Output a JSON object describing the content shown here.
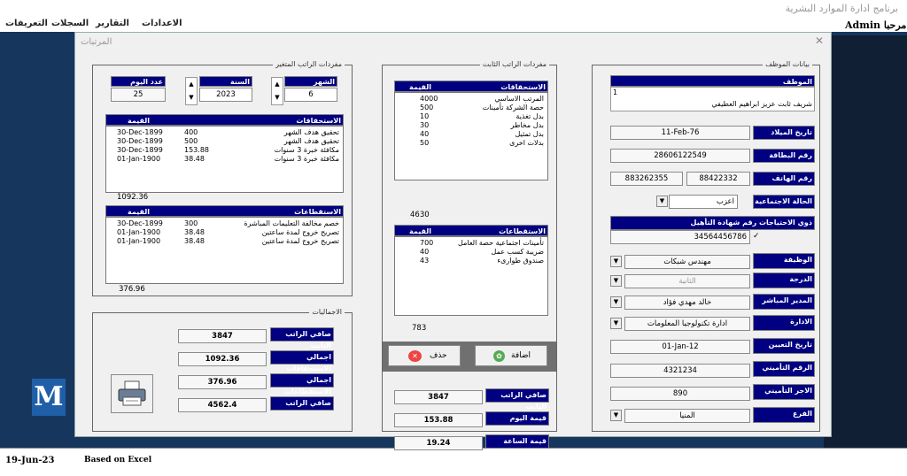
{
  "window": {
    "title": "برنامج ادارة الموارد البشرية",
    "welcome": "مرحبا Admin"
  },
  "menu": [
    "التعريفات",
    "السجلات",
    "التقارير",
    "الاعدادات"
  ],
  "status": {
    "date": "19-Jun-23",
    "based_on": "Based on Excel"
  },
  "logo_letter": "M",
  "dialog": {
    "title": "المرتبات",
    "close": "✕"
  },
  "employee": {
    "frame_label": "بيانات الموظف",
    "name_label": "الموظف",
    "id": "1",
    "name": "شريف ثابت عزيز ابراهيم العطيفي",
    "birth_label": "تاريخ الميلاد",
    "birth": "11-Feb-76",
    "card_label": "رقم البطاقة",
    "card": "28606122549",
    "phone_label": "رقم الهاتف",
    "phone1": "88422332",
    "phone2": "883262355",
    "social_label": "الحالة الاجتماعية",
    "social": "اعزب",
    "special_label": "ذوي الاحتياجات",
    "cert_label": "رقم شهادة التأهيل",
    "cert": "34564456786",
    "cert_check": "✓",
    "job_label": "الوظيفة",
    "job": "مهندس شبكات",
    "grade_label": "الدرجة",
    "grade": "الثانية",
    "manager_label": "المدير المباشر",
    "manager": "خالد مهدي فؤاد",
    "dept_label": "الادارة",
    "dept": "ادارة تكنولوجيا المعلومات",
    "hire_label": "تاريخ التعيين",
    "hire": "01-Jan-12",
    "ins_label": "الرقم التأميني",
    "ins": "4321234",
    "wage_label": "الاجر التأميني",
    "wage": "890",
    "branch_label": "الفرع",
    "branch": "المنيا"
  },
  "fixed": {
    "frame_label": "مفردات الراتب الثابت",
    "earn_hdr": "الاستحقاقات",
    "val_hdr": "القيمة",
    "earnings": [
      {
        "name": "المرتب الاساسي",
        "value": "4000"
      },
      {
        "name": "حصة الشركة تأمينات",
        "value": "500"
      },
      {
        "name": "بدل تغذية",
        "value": "10"
      },
      {
        "name": "بدل مخاطر",
        "value": "30"
      },
      {
        "name": "بدل تمثيل",
        "value": "40"
      },
      {
        "name": "بدلات اخرى",
        "value": "50"
      }
    ],
    "earn_total": "4630",
    "ded_hdr": "الاستقطاعات",
    "deductions": [
      {
        "name": "تأمينات اجتماعية حصة العامل",
        "value": "700"
      },
      {
        "name": "ضريبة كسب عمل",
        "value": "40"
      },
      {
        "name": "صندوق طوارىء",
        "value": "43"
      }
    ],
    "ded_total": "783",
    "add_btn": "اضافة",
    "del_btn": "حذف",
    "net_label": "صافي الراتب الثابت",
    "net": "3847",
    "day_label": "قيمة اليوم",
    "day": "153.88",
    "hour_label": "قيمة الساعة",
    "hour": "19.24"
  },
  "variable": {
    "frame_label": "مفردات الراتب المتغير",
    "month_label": "الشهر",
    "month": "6",
    "year_label": "السنة",
    "year": "2023",
    "days_label": "عدد اليوم",
    "days": "25",
    "earn_hdr": "الاستحقاقات",
    "val_hdr": "القيمة",
    "earnings": [
      {
        "name": "تحقيق هدف الشهر",
        "value": "400",
        "date": "30-Dec-1899"
      },
      {
        "name": "تحقيق هدف الشهر",
        "value": "500",
        "date": "30-Dec-1899"
      },
      {
        "name": "مكافئة خبرة 3 سنوات",
        "value": "153.88",
        "date": "30-Dec-1899"
      },
      {
        "name": "مكافئة خبرة 3 سنوات",
        "value": "38.48",
        "date": "01-Jan-1900"
      }
    ],
    "earn_total": "1092.36",
    "ded_hdr": "الاستقطاعات",
    "deductions": [
      {
        "name": "خصم مخالفة التعليمات المباشرة",
        "value": "300",
        "date": "30-Dec-1899"
      },
      {
        "name": "تصريح خروج لمدة ساعتين",
        "value": "38.48",
        "date": "01-Jan-1900"
      },
      {
        "name": "تصريح خروج لمدة ساعتين",
        "value": "38.48",
        "date": "01-Jan-1900"
      }
    ],
    "ded_total": "376.96"
  },
  "totals": {
    "frame_label": "الاجماليات",
    "fixed_label": "صافي الراتب الثابت",
    "fixed": "3847",
    "earn_label": "اجمالي الاستحقاقات",
    "earn": "1092.36",
    "ded_label": "اجمالي الاستقطاعات",
    "ded": "376.96",
    "net_label": "صافي الراتب",
    "net": "4562.4"
  },
  "colors": {
    "header": "#000080",
    "desktop": "#17365d"
  }
}
